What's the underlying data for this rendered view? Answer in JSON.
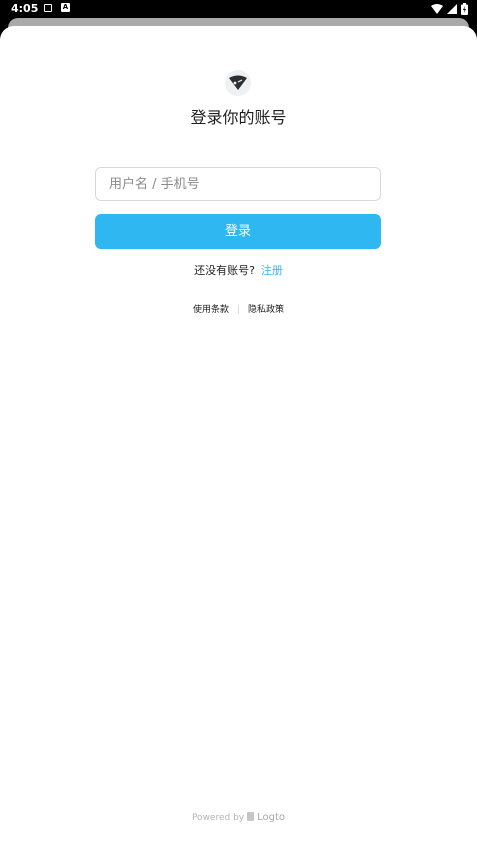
{
  "status_bar": {
    "time": "4:05",
    "a_badge": "A"
  },
  "app": {
    "title": "登录你的账号",
    "username_placeholder": "用户名 / 手机号",
    "username_value": "",
    "login_button": "登录",
    "no_account_text": "还没有账号?",
    "register_link": "注册",
    "terms_link": "使用条款",
    "privacy_link": "隐私政策",
    "powered_by": "Powered by",
    "powered_brand": "Logto"
  }
}
